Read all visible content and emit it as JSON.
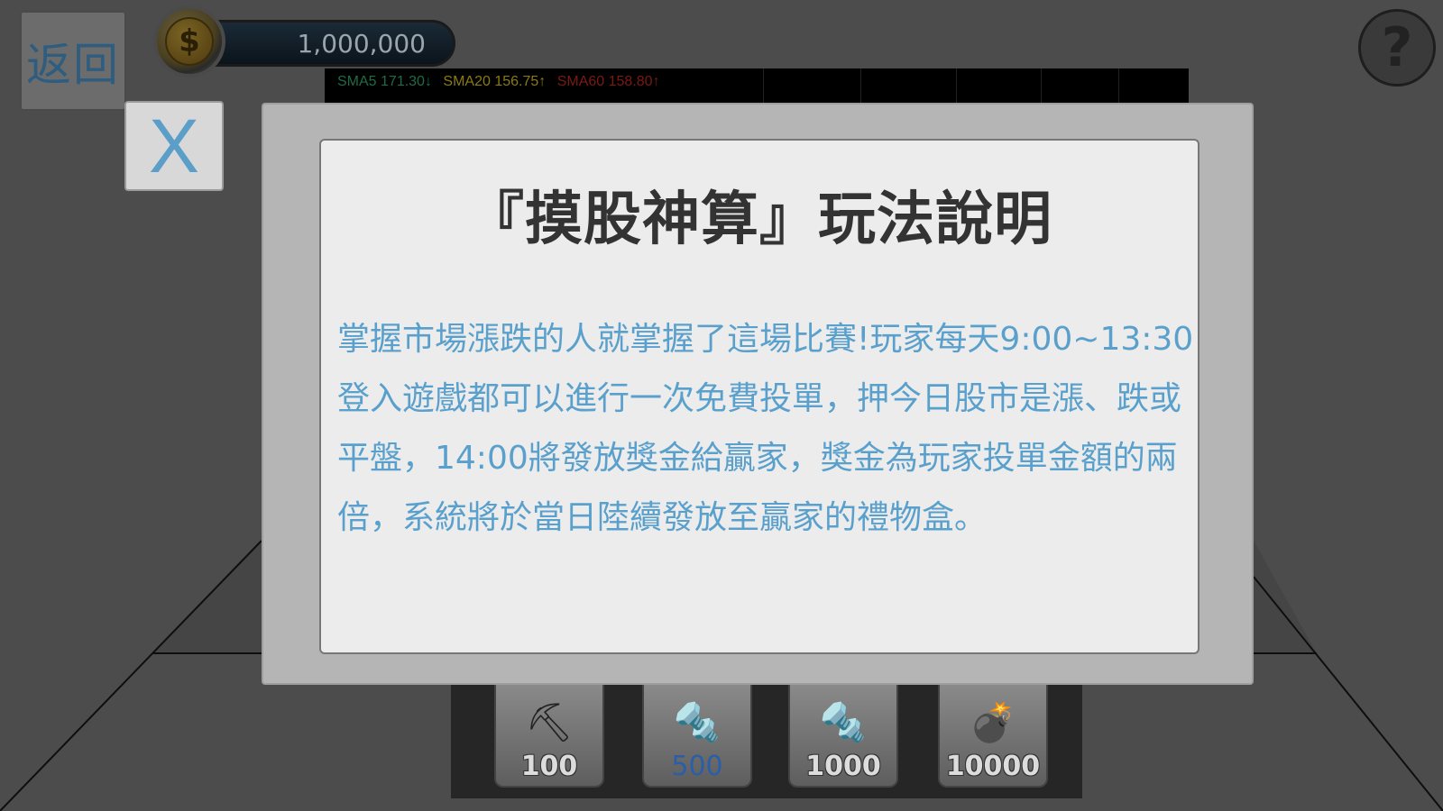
{
  "header": {
    "back_label": "返回",
    "coin_symbol": "$",
    "coin_amount": "1,000,000",
    "help_label": "?"
  },
  "sma": {
    "sma5": "SMA5 171.30↓",
    "sma20": "SMA20 156.75↑",
    "sma60": "SMA60 158.80↑"
  },
  "modal": {
    "close_label": "X",
    "title": "『摸股神算』玩法說明",
    "body": "掌握市場漲跌的人就掌握了這場比賽!玩家每天9:00~13:30登入遊戲都可以進行一次免費投單，押今日股市是漲、跌或平盤，14:00將發放獎金給贏家，獎金為玩家投單金額的兩倍，系統將於當日陸續發放至贏家的禮物盒。"
  },
  "tools": [
    {
      "icon": "shovel-icon",
      "price": "100"
    },
    {
      "icon": "drill-icon",
      "price": "500"
    },
    {
      "icon": "double-drill-icon",
      "price": "1000"
    },
    {
      "icon": "bomb-icon",
      "price": "10000"
    }
  ],
  "colors": {
    "modal_text": "#5aa0cc",
    "close_x": "#5b9ec8",
    "sma5": "#1f6b48",
    "sma20": "#8a7a14",
    "sma60": "#7a1a10"
  }
}
